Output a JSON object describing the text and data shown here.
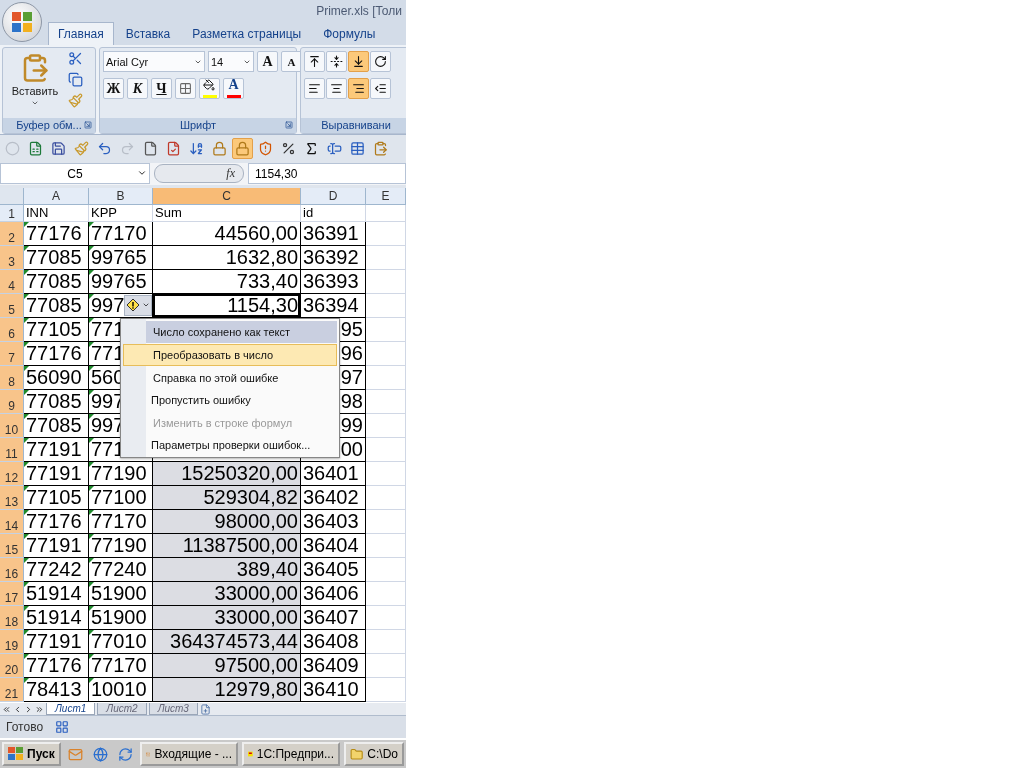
{
  "title_bar": {
    "title": "Primer.xls  [Толи"
  },
  "ribbon_tabs": [
    {
      "label": "Главная",
      "selected": true
    },
    {
      "label": "Вставка",
      "selected": false
    },
    {
      "label": "Разметка страницы",
      "selected": false
    },
    {
      "label": "Формулы",
      "selected": false
    }
  ],
  "clipboard_group": {
    "paste_label": "Вставить",
    "label": "Буфер обм..."
  },
  "font_group": {
    "font_name": "Arial Cyr",
    "font_size": "14",
    "grow_glyph": "A",
    "shrink_glyph": "A",
    "style_buttons": [
      "Ж",
      "К",
      "Ч"
    ],
    "font_color_glyph": "A",
    "label": "Шрифт"
  },
  "alignment_group": {
    "label": "Выравнивани",
    "buttons": [
      {
        "kind": "top",
        "on": false
      },
      {
        "kind": "middle",
        "on": false
      },
      {
        "kind": "bottom",
        "on": true
      },
      {
        "kind": "orient",
        "on": false
      },
      {
        "kind": "left",
        "on": false
      },
      {
        "kind": "center",
        "on": false
      },
      {
        "kind": "right",
        "on": true
      },
      {
        "kind": "indent",
        "on": false
      }
    ]
  },
  "quick_access_toolbar": [
    {
      "on": false
    },
    {
      "on": false
    },
    {
      "on": false
    },
    {
      "on": false
    },
    {
      "on": false
    },
    {
      "on": false
    },
    {
      "on": false
    },
    {
      "on": false
    },
    {
      "on": false
    },
    {
      "on": false
    },
    {
      "on": true
    },
    {
      "on": false
    },
    {
      "on": false
    },
    {
      "on": false
    },
    {
      "on": false
    },
    {
      "on": false
    },
    {
      "on": false
    }
  ],
  "formula_bar": {
    "name_box": "C5",
    "function_label": "fx",
    "value": "1154,30"
  },
  "columns": [
    {
      "label": "A",
      "selected": false
    },
    {
      "label": "B",
      "selected": false
    },
    {
      "label": "C",
      "selected": true
    },
    {
      "label": "D",
      "selected": false
    },
    {
      "label": "E",
      "selected": false
    }
  ],
  "header_row": {
    "number": "1",
    "cells": [
      "INN",
      "KPP",
      "Sum",
      "id"
    ]
  },
  "rows": [
    {
      "number": "2",
      "selected": true,
      "active": false,
      "covered": false,
      "shaded": false,
      "a": "77176",
      "b": "77170",
      "c": "44560,00",
      "d": "36391"
    },
    {
      "number": "3",
      "selected": true,
      "active": false,
      "covered": false,
      "shaded": false,
      "a": "77085",
      "b": "99765",
      "c": "1632,80",
      "d": "36392"
    },
    {
      "number": "4",
      "selected": true,
      "active": false,
      "covered": false,
      "shaded": false,
      "a": "77085",
      "b": "99765",
      "c": "733,40",
      "d": "36393"
    },
    {
      "number": "5",
      "selected": true,
      "active": true,
      "covered": false,
      "shaded": false,
      "a": "77085",
      "b": "997",
      "c": "1154,30",
      "d": "36394"
    },
    {
      "number": "6",
      "selected": true,
      "active": false,
      "covered": true,
      "a": "77105",
      "b": "771",
      "d": "95"
    },
    {
      "number": "7",
      "selected": true,
      "active": false,
      "covered": true,
      "a": "77176",
      "b": "771",
      "d": "96"
    },
    {
      "number": "8",
      "selected": true,
      "active": false,
      "covered": true,
      "a": "56090",
      "b": "560",
      "d": "97"
    },
    {
      "number": "9",
      "selected": true,
      "active": false,
      "covered": true,
      "a": "77085",
      "b": "997",
      "d": "98"
    },
    {
      "number": "10",
      "selected": true,
      "active": false,
      "covered": true,
      "a": "77085",
      "b": "997",
      "d": "99"
    },
    {
      "number": "11",
      "selected": true,
      "active": false,
      "covered": true,
      "a": "77191",
      "b": "771",
      "d": "00"
    },
    {
      "number": "12",
      "selected": true,
      "active": false,
      "covered": false,
      "shaded": true,
      "a": "77191",
      "b": "77190",
      "c": "15250320,00",
      "d": "36401"
    },
    {
      "number": "13",
      "selected": true,
      "active": false,
      "covered": false,
      "shaded": true,
      "a": "77105",
      "b": "77100",
      "c": "529304,82",
      "d": "36402"
    },
    {
      "number": "14",
      "selected": true,
      "active": false,
      "covered": false,
      "shaded": true,
      "a": "77176",
      "b": "77170",
      "c": "98000,00",
      "d": "36403"
    },
    {
      "number": "15",
      "selected": true,
      "active": false,
      "covered": false,
      "shaded": true,
      "a": "77191",
      "b": "77190",
      "c": "11387500,00",
      "d": "36404"
    },
    {
      "number": "16",
      "selected": true,
      "active": false,
      "covered": false,
      "shaded": true,
      "a": "77242",
      "b": "77240",
      "c": "389,40",
      "d": "36405"
    },
    {
      "number": "17",
      "selected": true,
      "active": false,
      "covered": false,
      "shaded": true,
      "a": "51914",
      "b": "51900",
      "c": "33000,00",
      "d": "36406"
    },
    {
      "number": "18",
      "selected": true,
      "active": false,
      "covered": false,
      "shaded": true,
      "a": "51914",
      "b": "51900",
      "c": "33000,00",
      "d": "36407"
    },
    {
      "number": "19",
      "selected": true,
      "active": false,
      "covered": false,
      "shaded": true,
      "a": "77191",
      "b": "77010",
      "c": "364374573,44",
      "d": "36408"
    },
    {
      "number": "20",
      "selected": true,
      "active": false,
      "covered": false,
      "shaded": true,
      "a": "77176",
      "b": "77170",
      "c": "97500,00",
      "d": "36409"
    },
    {
      "number": "21",
      "selected": true,
      "active": false,
      "covered": false,
      "shaded": true,
      "a": "78413",
      "b": "10010",
      "c": "12979,80",
      "d": "36410"
    }
  ],
  "error_menu": {
    "items": [
      {
        "kind": "header",
        "label": "Число сохранено как текст",
        "selected": false,
        "disabled": false,
        "separator_before": false
      },
      {
        "kind": "item",
        "label": "Преобразовать в число",
        "selected": true,
        "disabled": false,
        "separator_before": false
      },
      {
        "kind": "item",
        "label": "Справка по этой ошибке",
        "selected": false,
        "disabled": false,
        "separator_before": false
      },
      {
        "kind": "item",
        "label": "Пропустить ошибку",
        "selected": false,
        "disabled": false,
        "separator_before": true
      },
      {
        "kind": "item",
        "label": "Изменить в строке формул",
        "selected": false,
        "disabled": true,
        "separator_before": false
      },
      {
        "kind": "item",
        "label": "Параметры проверки ошибок...",
        "selected": false,
        "disabled": false,
        "separator_before": true
      }
    ]
  },
  "sheet_tabs": [
    {
      "label": "Лист1",
      "selected": true
    },
    {
      "label": "Лист2",
      "selected": false
    },
    {
      "label": "Лист3",
      "selected": false
    }
  ],
  "status_bar": {
    "text": "Готово"
  },
  "taskbar": {
    "start_label": "Пуск",
    "tasks": [
      {
        "kind": "mail",
        "label": "Входящие - ..."
      },
      {
        "kind": "onec",
        "label": "1С:Предпри..."
      },
      {
        "kind": "folder",
        "label": "C:\\Do"
      }
    ]
  }
}
